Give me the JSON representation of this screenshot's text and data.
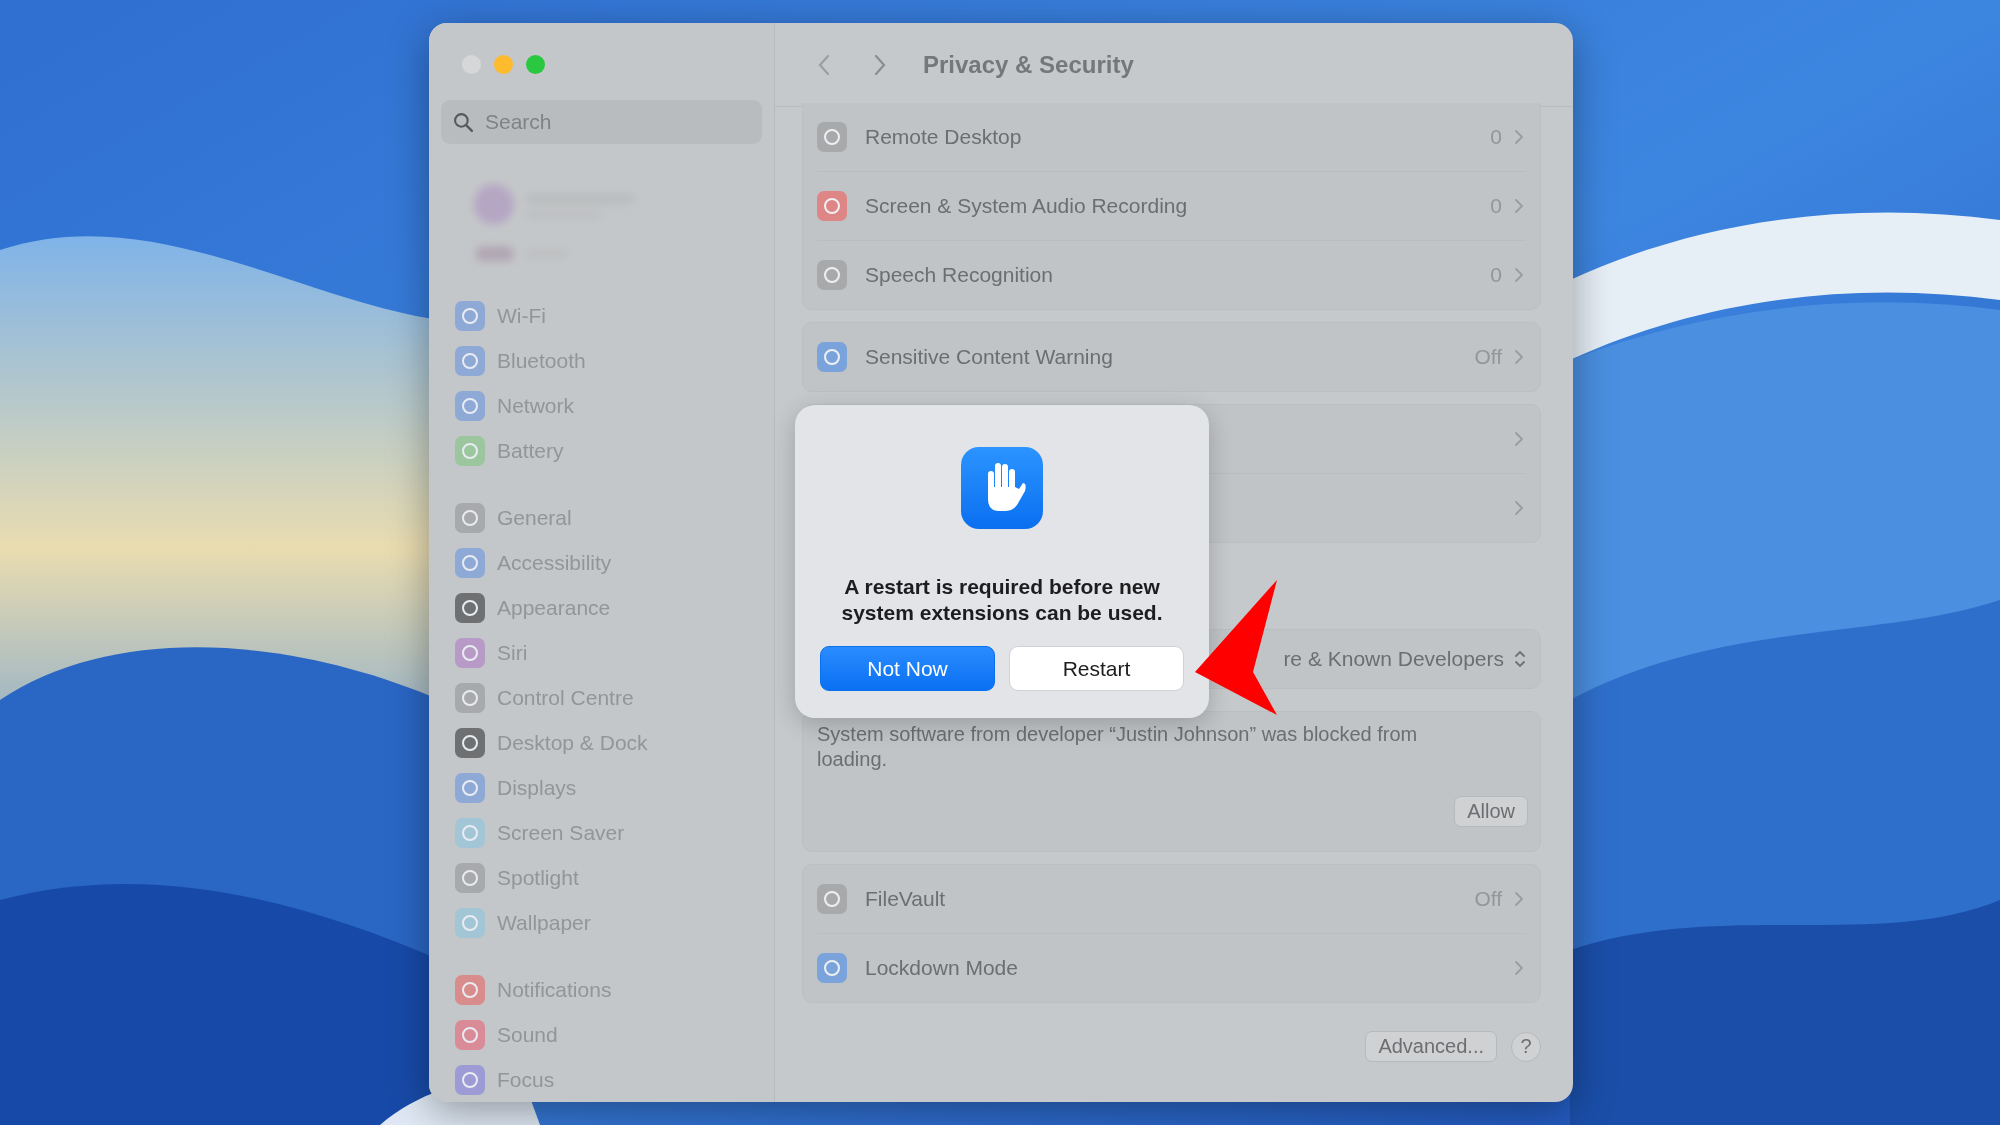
{
  "window": {
    "title": "Privacy & Security"
  },
  "sidebar": {
    "search": {
      "placeholder": "Search"
    },
    "groups": [
      {
        "items": [
          {
            "label": "Wi-Fi",
            "color": "#8fa9d6"
          },
          {
            "label": "Bluetooth",
            "color": "#8fa9d6"
          },
          {
            "label": "Network",
            "color": "#8fa9d6"
          },
          {
            "label": "Battery",
            "color": "#9cc79e"
          }
        ]
      },
      {
        "items": [
          {
            "label": "General",
            "color": "#a7a9ab"
          },
          {
            "label": "Accessibility",
            "color": "#8fa9d6"
          },
          {
            "label": "Appearance",
            "color": "#6e7072"
          },
          {
            "label": "Siri",
            "color": "#b79bc6"
          },
          {
            "label": "Control Centre",
            "color": "#a7a9ab"
          },
          {
            "label": "Desktop & Dock",
            "color": "#6e7072"
          },
          {
            "label": "Displays",
            "color": "#8fa9d6"
          },
          {
            "label": "Screen Saver",
            "color": "#a3c6d6"
          },
          {
            "label": "Spotlight",
            "color": "#a7a9ab"
          },
          {
            "label": "Wallpaper",
            "color": "#a3c6d6"
          }
        ]
      },
      {
        "items": [
          {
            "label": "Notifications",
            "color": "#d98c8c"
          },
          {
            "label": "Sound",
            "color": "#d98c98"
          },
          {
            "label": "Focus",
            "color": "#9d9bd6"
          }
        ]
      }
    ]
  },
  "cards": [
    {
      "kind": "list",
      "rows": [
        {
          "label": "Remote Desktop",
          "value": "0",
          "color": "#a7a9ab"
        },
        {
          "label": "Screen & System Audio Recording",
          "value": "0",
          "color": "#de8585"
        },
        {
          "label": "Speech Recognition",
          "value": "0",
          "color": "#a7a9ab"
        }
      ]
    },
    {
      "kind": "list",
      "rows": [
        {
          "label": "Sensitive Content Warning",
          "value": "Off",
          "color": "#7aa3dc"
        }
      ]
    },
    {
      "kind": "covered",
      "rows": [
        {
          "kind": "link"
        },
        {
          "kind": "link"
        }
      ]
    },
    {
      "kind": "popup",
      "value": "re & Known Developers"
    },
    {
      "kind": "notice",
      "text": "System software from developer “Justin Johnson” was blocked from loading.",
      "button": "Allow"
    },
    {
      "kind": "list",
      "rows": [
        {
          "label": "FileVault",
          "value": "Off",
          "color": "#a7a9ab"
        },
        {
          "label": "Lockdown Mode",
          "color": "#7aa3dc"
        }
      ]
    }
  ],
  "footer": {
    "buttons": [
      "Advanced...",
      "?"
    ]
  },
  "dialog": {
    "message": "A restart is required before new system extensions can be used.",
    "buttons": [
      {
        "label": "Not Now",
        "default": true
      },
      {
        "label": "Restart",
        "default": false
      }
    ]
  },
  "annotation": {
    "kind": "arrow",
    "color": "#ff0000"
  }
}
